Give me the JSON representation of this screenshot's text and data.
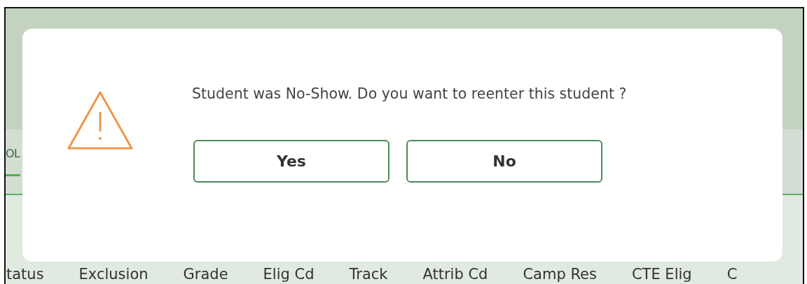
{
  "tabs": [
    {
      "label": "OL",
      "selected": true
    }
  ],
  "columns": [
    "tatus",
    "Exclusion",
    "Grade",
    "Elig Cd",
    "Track",
    "Attrib Cd",
    "Camp Res",
    "CTE Elig",
    "C"
  ],
  "dialog": {
    "message": "Student was No-Show. Do you want to reenter this student ?",
    "buttons": [
      {
        "label": "Yes"
      },
      {
        "label": "No"
      }
    ]
  }
}
